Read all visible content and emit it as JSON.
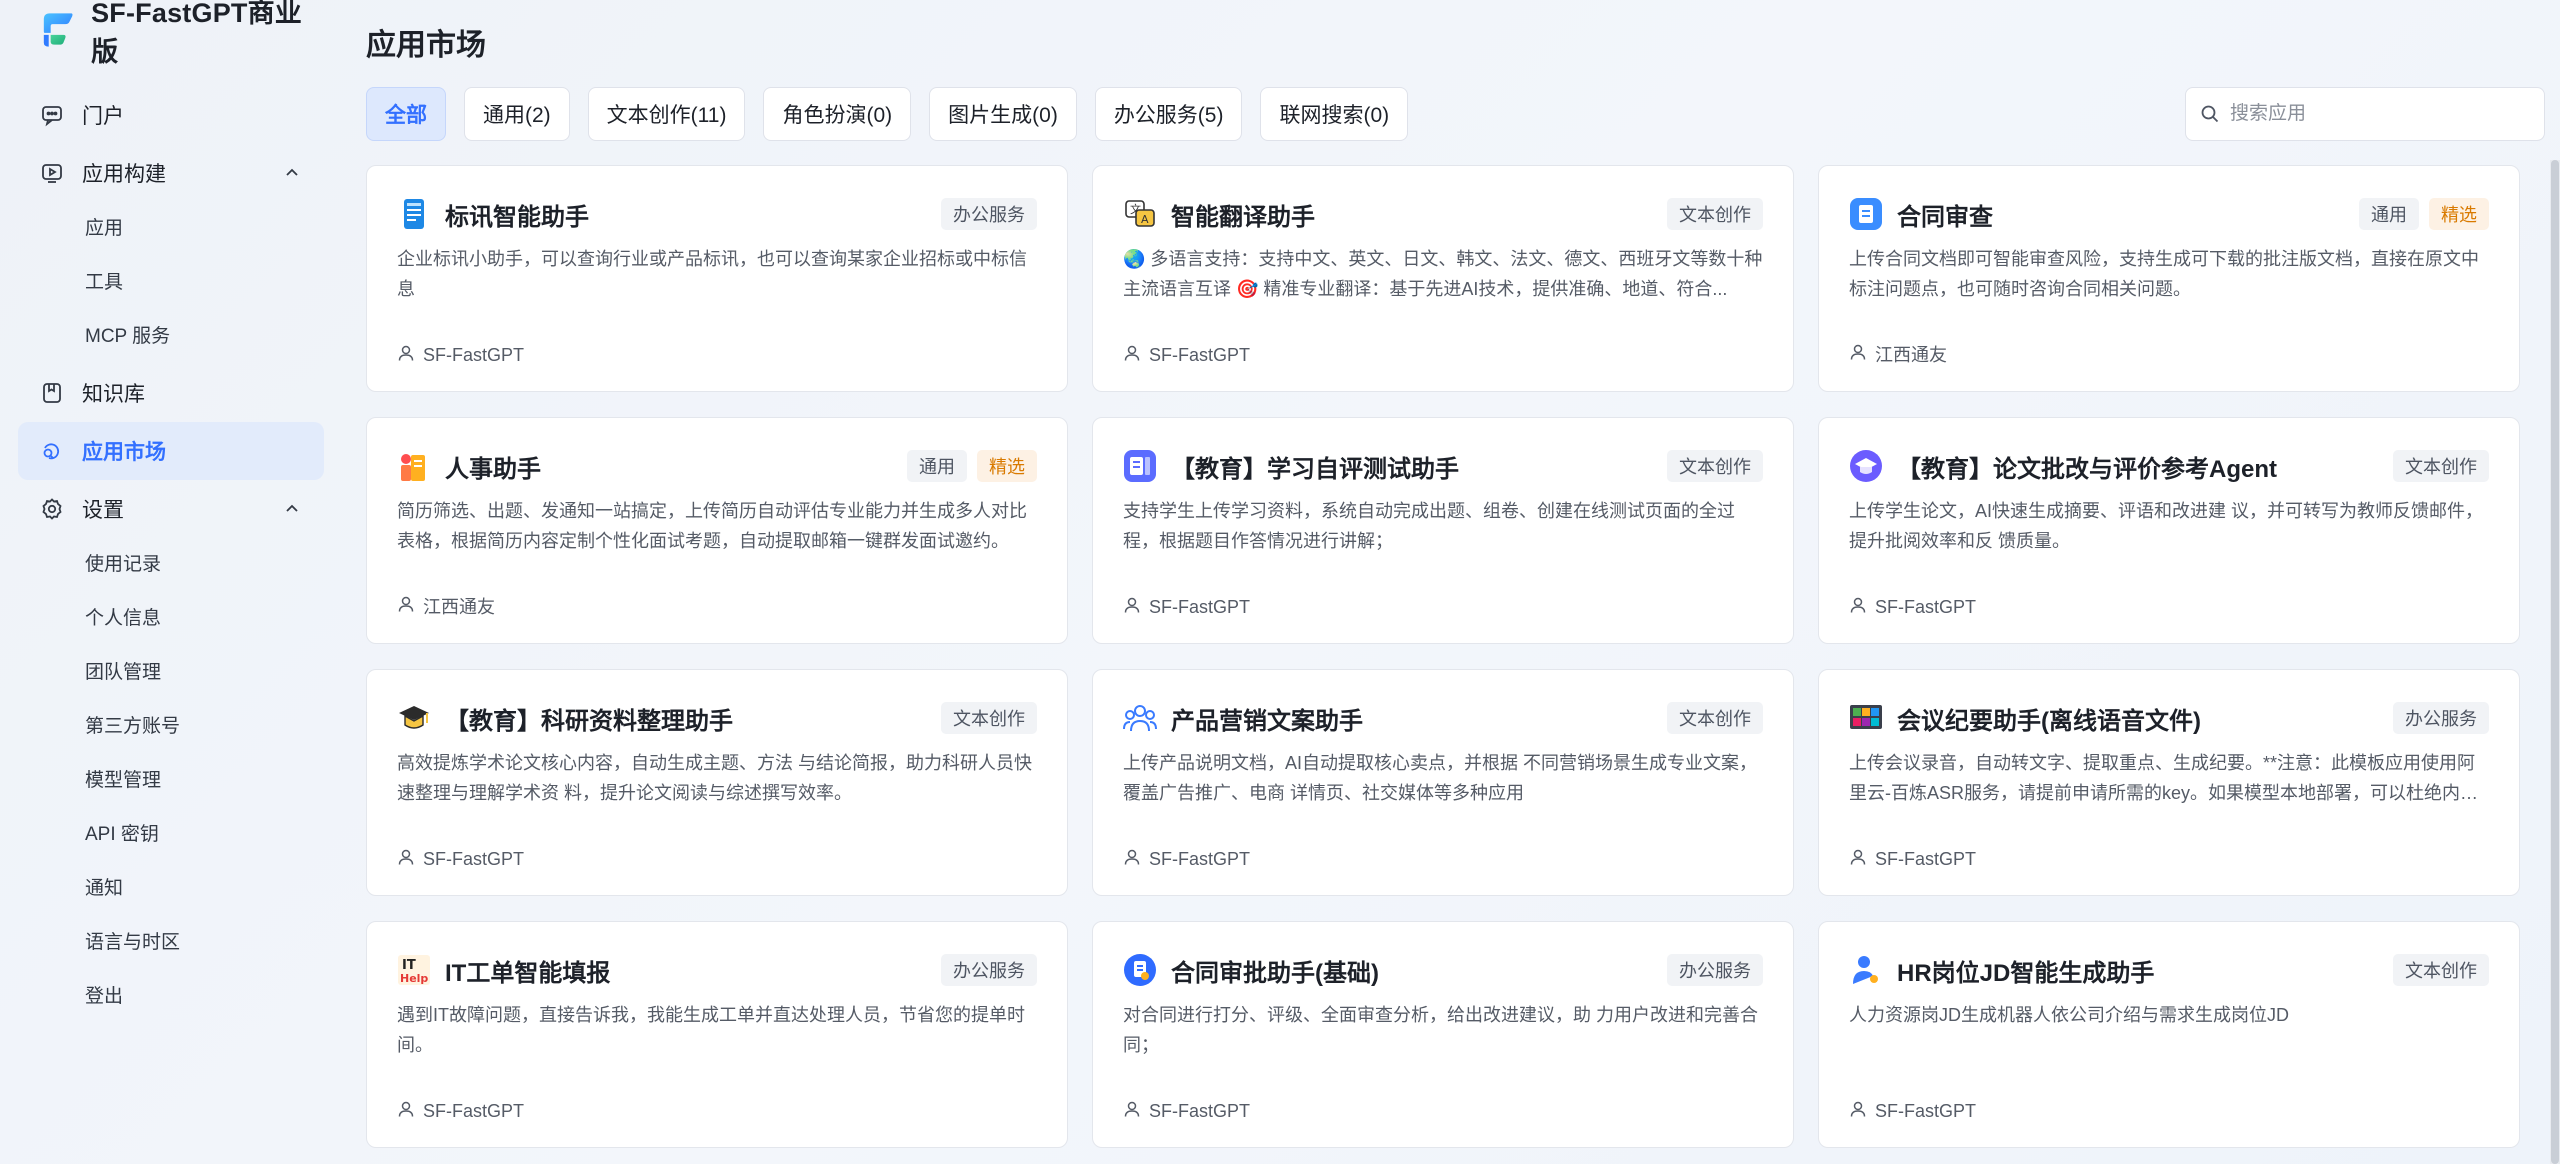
{
  "brand": {
    "name": "SF-FastGPT商业版"
  },
  "sidebar": {
    "items": [
      {
        "label": "门户",
        "icon": "chat-icon"
      },
      {
        "label": "应用构建",
        "icon": "play-screen-icon",
        "expanded": true,
        "children": [
          "应用",
          "工具",
          "MCP 服务"
        ]
      },
      {
        "label": "知识库",
        "icon": "book-icon"
      },
      {
        "label": "应用市场",
        "icon": "market-icon",
        "active": true
      },
      {
        "label": "设置",
        "icon": "gear-icon",
        "expanded": true,
        "children": [
          "使用记录",
          "个人信息",
          "团队管理",
          "第三方账号",
          "模型管理",
          "API 密钥",
          "通知",
          "语言与时区",
          "登出"
        ]
      }
    ]
  },
  "main": {
    "title": "应用市场",
    "filters": [
      "全部",
      "通用(2)",
      "文本创作(11)",
      "角色扮演(0)",
      "图片生成(0)",
      "办公服务(5)",
      "联网搜索(0)"
    ],
    "active_filter": "全部",
    "search": {
      "placeholder": "搜索应用",
      "value": ""
    },
    "cards": [
      {
        "title": "标讯智能助手",
        "icon": "bid-doc-icon",
        "tags": [
          "办公服务"
        ],
        "desc": "企业标讯小助手，可以查询行业或产品标讯，也可以查询某家企业招标或中标信息",
        "author": "SF-FastGPT"
      },
      {
        "title": "智能翻译助手",
        "icon": "translate-icon",
        "tags": [
          "文本创作"
        ],
        "desc": "🌏 多语言支持：支持中文、英文、日文、韩文、法文、德文、西班牙文等数十种主流语言互译 🎯 精准专业翻译：基于先进AI技术，提供准确、地道、符合...",
        "author": "SF-FastGPT"
      },
      {
        "title": "合同审查",
        "icon": "contract-icon",
        "tags": [
          "通用",
          "精选"
        ],
        "desc": "上传合同文档即可智能审查风险，支持生成可下载的批注版文档，直接在原文中标注问题点，也可随时咨询合同相关问题。",
        "author": "江西通友"
      },
      {
        "title": "人事助手",
        "icon": "hr-icon",
        "tags": [
          "通用",
          "精选"
        ],
        "desc": "简历筛选、出题、发通知一站搞定，上传简历自动评估专业能力并生成多人对比表格，根据简历内容定制个性化面试考题，自动提取邮箱一键群发面试邀约。",
        "author": "江西通友"
      },
      {
        "title": "【教育】学习自评测试助手",
        "icon": "quiz-icon",
        "tags": [
          "文本创作"
        ],
        "desc": "支持学生上传学习资料，系统自动完成出题、组卷、创建在线测试页面的全过程，根据题目作答情况进行讲解；",
        "author": "SF-FastGPT"
      },
      {
        "title": "【教育】论文批改与评价参考Agent",
        "icon": "graduation-cap-icon",
        "tags": [
          "文本创作"
        ],
        "desc": "上传学生论文，AI快速生成摘要、评语和改进建 议，并可转写为教师反馈邮件，提升批阅效率和反 馈质量。",
        "author": "SF-FastGPT"
      },
      {
        "title": "【教育】科研资料整理助手",
        "icon": "mortarboard-icon",
        "tags": [
          "文本创作"
        ],
        "desc": "高效提炼学术论文核心内容，自动生成主题、方法 与结论简报，助力科研人员快速整理与理解学术资 料，提升论文阅读与综述撰写效率。",
        "author": "SF-FastGPT"
      },
      {
        "title": "产品营销文案助手",
        "icon": "team-icon",
        "tags": [
          "文本创作"
        ],
        "desc": "上传产品说明文档，AI自动提取核心卖点，并根据 不同营销场景生成专业文案，覆盖广告推广、电商 详情页、社交媒体等多种应用",
        "author": "SF-FastGPT"
      },
      {
        "title": "会议纪要助手(离线语音文件)",
        "icon": "meeting-icon",
        "tags": [
          "办公服务"
        ],
        "desc": "上传会议录音，自动转文字、提取重点、生成纪要。**注意：此模板应用使用阿里云-百炼ASR服务，请提前申请所需的key。如果模型本地部署，可以杜绝内部...",
        "author": "SF-FastGPT"
      },
      {
        "title": "IT工单智能填报",
        "icon": "it-help-icon",
        "tags": [
          "办公服务"
        ],
        "desc": "遇到IT故障问题，直接告诉我，我能生成工单并直达处理人员，节省您的提单时间。",
        "author": "SF-FastGPT"
      },
      {
        "title": "合同审批助手(基础)",
        "icon": "approval-icon",
        "tags": [
          "办公服务"
        ],
        "desc": "对合同进行打分、评级、全面审查分析，给出改进建议，助 力用户改进和完善合同；",
        "author": "SF-FastGPT"
      },
      {
        "title": "HR岗位JD智能生成助手",
        "icon": "person-icon",
        "tags": [
          "文本创作"
        ],
        "desc": "人力资源岗JD生成机器人依公司介绍与需求生成岗位JD",
        "author": "SF-FastGPT"
      }
    ]
  },
  "colors": {
    "accent": "#3370ff",
    "active_bg": "#e2ebfb",
    "featured": "#d97a00"
  }
}
